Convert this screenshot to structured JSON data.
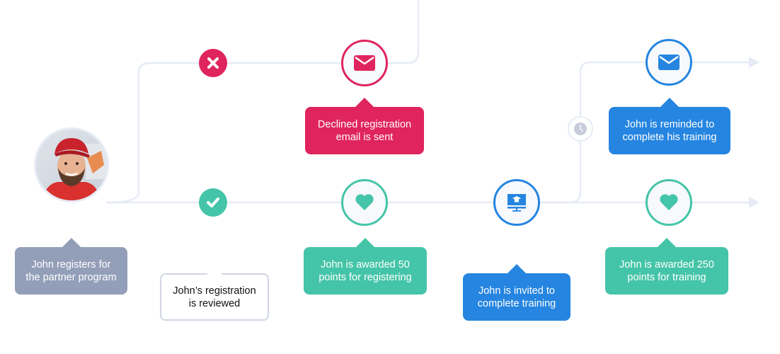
{
  "colors": {
    "line": "#e6ebf5",
    "decline": "#e0245e",
    "success": "#44c4a8",
    "info": "#2585e0",
    "neutral": "#939fb8",
    "clock": "#c6ccdb"
  },
  "avatar": {
    "label": "John"
  },
  "nodes": {
    "decline": {
      "icon": "x-icon"
    },
    "declined_email": {
      "icon": "envelope-icon"
    },
    "approved": {
      "icon": "check-icon"
    },
    "points_registering": {
      "icon": "heart-icon"
    },
    "training_invite": {
      "icon": "monitor-graduation-cap-icon"
    },
    "wait": {
      "icon": "clock-icon"
    },
    "reminder_email": {
      "icon": "envelope-icon"
    },
    "points_training": {
      "icon": "heart-icon"
    }
  },
  "bubbles": {
    "registers": "John registers for\nthe partner program",
    "reviewed": "John’s registration\nis reviewed",
    "declined_email": "Declined registration\nemail is sent",
    "awarded_50": "John is awarded 50\npoints for registering",
    "invited_training": "John is invited to\ncomplete training",
    "reminded": "John is reminded to\ncomplete his training",
    "awarded_250": "John is awarded 250\npoints for training"
  }
}
